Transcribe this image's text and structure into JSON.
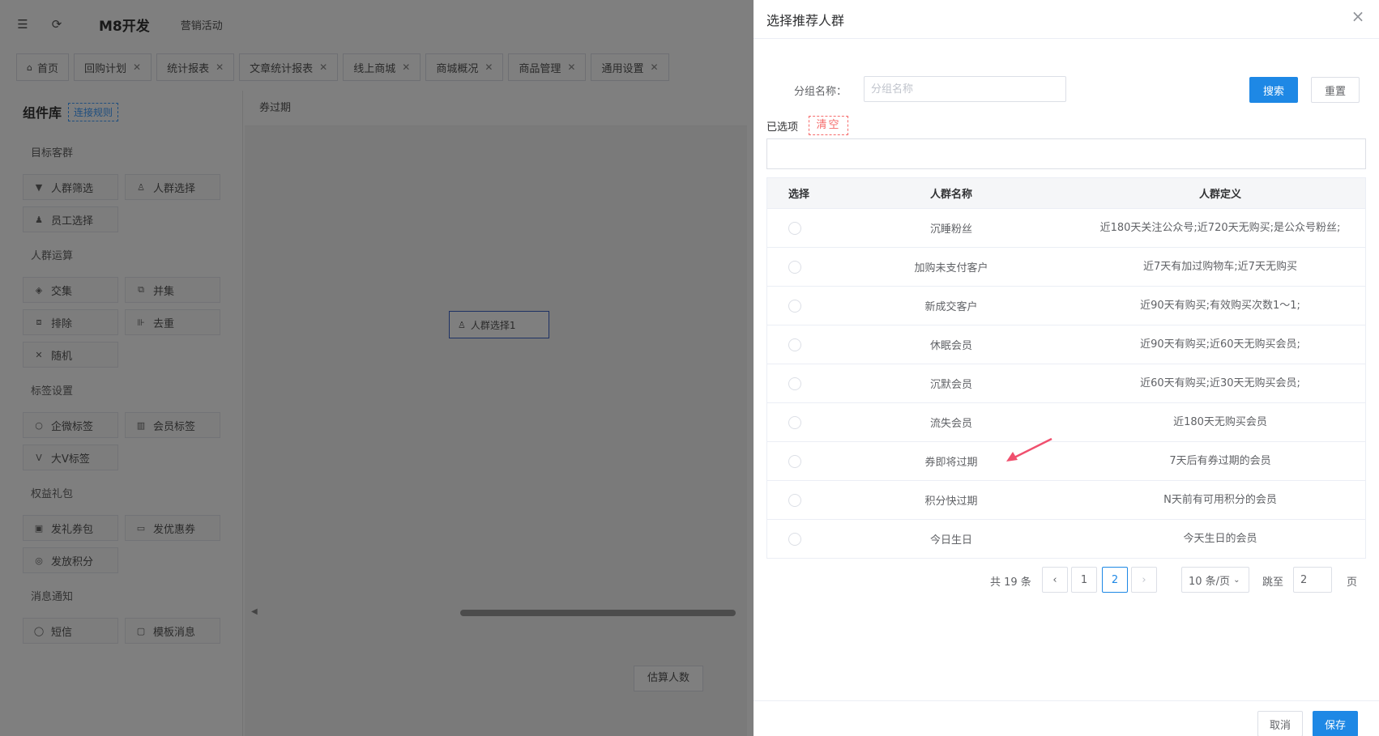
{
  "app": {
    "title": "M8开发",
    "breadcrumb": "营销活动"
  },
  "tabs": [
    {
      "label": "首页"
    },
    {
      "label": "回购计划"
    },
    {
      "label": "统计报表"
    },
    {
      "label": "文章统计报表"
    },
    {
      "label": "线上商城"
    },
    {
      "label": "商城概况"
    },
    {
      "label": "商品管理"
    },
    {
      "label": "通用设置"
    }
  ],
  "component_library": {
    "title": "组件库",
    "rule_link": "连接规则",
    "groups": [
      {
        "title": "目标客群",
        "items": [
          "人群筛选",
          "人群选择",
          "员工选择"
        ]
      },
      {
        "title": "人群运算",
        "items": [
          "交集",
          "并集",
          "排除",
          "去重",
          "随机"
        ]
      },
      {
        "title": "标签设置",
        "items": [
          "企微标签",
          "会员标签",
          "大V标签"
        ]
      },
      {
        "title": "权益礼包",
        "items": [
          "发礼券包",
          "发优惠券",
          "发放积分"
        ]
      },
      {
        "title": "消息通知",
        "items": [
          "短信",
          "模板消息"
        ]
      }
    ]
  },
  "canvas": {
    "header": "券过期",
    "node_label": "人群选择1",
    "estimate_button": "估算人数"
  },
  "drawer": {
    "title": "选择推荐人群",
    "search": {
      "label": "分组名称：",
      "placeholder": "分组名称",
      "value": "",
      "search_button": "搜索",
      "reset_button": "重置"
    },
    "selected": {
      "label": "已选项",
      "clear_button": "清空"
    },
    "table": {
      "columns": [
        "选择",
        "人群名称",
        "人群定义"
      ],
      "rows": [
        {
          "name": "沉睡粉丝",
          "definition": "近180天关注公众号;近720天无购买;是公众号粉丝;"
        },
        {
          "name": "加购未支付客户",
          "definition": "近7天有加过购物车;近7天无购买"
        },
        {
          "name": "新成交客户",
          "definition": "近90天有购买;有效购买次数1～1;"
        },
        {
          "name": "休眠会员",
          "definition": "近90天有购买;近60天无购买会员;"
        },
        {
          "name": "沉默会员",
          "definition": "近60天有购买;近30天无购买会员;"
        },
        {
          "name": "流失会员",
          "definition": "近180天无购买会员"
        },
        {
          "name": "券即将过期",
          "definition": "7天后有券过期的会员"
        },
        {
          "name": "积分快过期",
          "definition": "N天前有可用积分的会员"
        },
        {
          "name": "今日生日",
          "definition": "今天生日的会员"
        }
      ]
    },
    "pagination": {
      "total": "共 19 条",
      "pages": [
        "1",
        "2"
      ],
      "current_page": "2",
      "page_size": "10 条/页",
      "jump_label": "跳至",
      "jump_value": "2",
      "jump_suffix": "页"
    },
    "footer": {
      "cancel_button": "取消",
      "save_button": "保存"
    }
  },
  "colors": {
    "primary": "#1e88e5",
    "danger": "#f56c6c",
    "annotation_arrow": "#f0506e"
  }
}
